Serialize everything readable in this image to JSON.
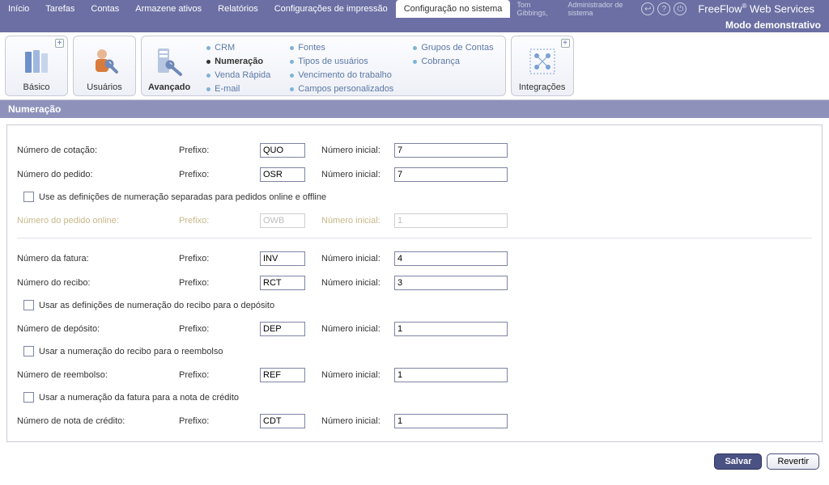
{
  "topmenu": {
    "items": [
      "Início",
      "Tarefas",
      "Contas",
      "Armazene ativos",
      "Relatórios",
      "Configurações de impressão",
      "Configuração no sistema"
    ],
    "active_index": 6
  },
  "user": {
    "name": "Tom Gibbings,",
    "role": "Administrador de sistema"
  },
  "brand": {
    "name": "FreeFlow",
    "suffix": " Web Services",
    "reg": "®"
  },
  "mode_label": "Modo demonstrativo",
  "ribbon": {
    "basic": "Básico",
    "users": "Usuários",
    "advanced": "Avançado",
    "integrations": "Integrações",
    "links": {
      "col1": [
        "CRM",
        "Numeração",
        "Venda Rápida",
        "E-mail"
      ],
      "col2": [
        "Fontes",
        "Tipos de usuários",
        "Vencimento do trabalho",
        "Campos personalizados"
      ],
      "col3": [
        "Grupos de Contas",
        "Cobrança"
      ],
      "active": "Numeração"
    }
  },
  "section_title": "Numeração",
  "labels": {
    "prefix": "Prefixo:",
    "initial": "Número inicial:",
    "quote": "Número de cotação:",
    "order": "Número do pedido:",
    "online_order": "Número do pedido online:",
    "invoice": "Número da fatura:",
    "receipt": "Número do recibo:",
    "deposit": "Número de depósito:",
    "refund": "Número de reembolso:",
    "credit": "Número de nota de crédito:",
    "chk_split_orders": "Use as definições de numeração separadas para pedidos online e offline",
    "chk_receipt_deposit": "Usar as definições de numeração do recibo para o depósito",
    "chk_receipt_refund": "Usar a numeração do recibo para o reembolso",
    "chk_invoice_credit": "Usar a numeração da fatura para a nota de crédito"
  },
  "values": {
    "quote_prefix": "QUO",
    "quote_num": "7",
    "order_prefix": "OSR",
    "order_num": "7",
    "online_prefix": "OWB",
    "online_num": "1",
    "invoice_prefix": "INV",
    "invoice_num": "4",
    "receipt_prefix": "RCT",
    "receipt_num": "3",
    "deposit_prefix": "DEP",
    "deposit_num": "1",
    "refund_prefix": "REF",
    "refund_num": "1",
    "credit_prefix": "CDT",
    "credit_num": "1"
  },
  "buttons": {
    "save": "Salvar",
    "revert": "Revertir"
  }
}
